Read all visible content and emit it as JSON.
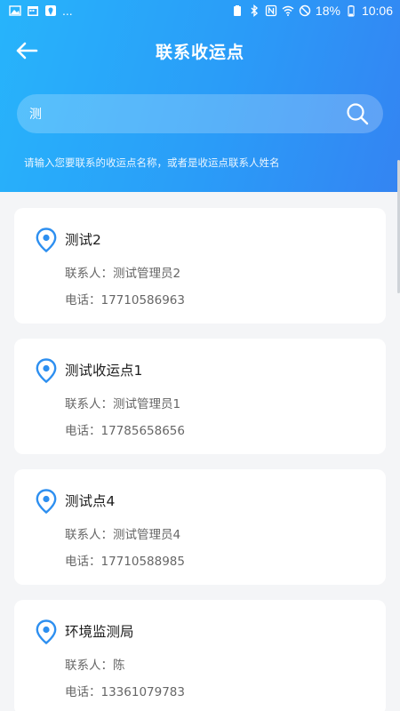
{
  "status_bar": {
    "ellipsis": "...",
    "battery": "18%",
    "time": "10:06"
  },
  "header": {
    "title": "联系收运点",
    "search_value": "测",
    "hint": "请输入您要联系的收运点名称，或者是收运点联系人姓名"
  },
  "icons": {
    "back": "arrow-left-icon",
    "search": "search-icon",
    "pin": "location-pin-icon"
  },
  "colors": {
    "header_start": "#27b4fb",
    "header_end": "#3484f2",
    "pin": "#2d8ff0"
  },
  "items": [
    {
      "name": "测试2",
      "contact": "联系人：测试管理员2",
      "phone": "电话：17710586963"
    },
    {
      "name": "测试收运点1",
      "contact": "联系人：测试管理员1",
      "phone": "电话：17785658656"
    },
    {
      "name": "测试点4",
      "contact": "联系人：测试管理员4",
      "phone": "电话：17710588985"
    },
    {
      "name": "环境监测局",
      "contact": "联系人：陈",
      "phone": "电话：13361079783"
    }
  ]
}
